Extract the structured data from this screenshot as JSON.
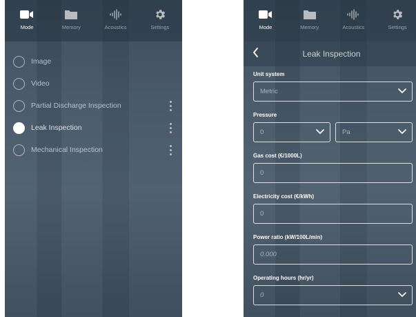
{
  "nav": {
    "mode": "Mode",
    "memory": "Memory",
    "acoustics": "Acoustics",
    "settings": "Settings"
  },
  "mode_list": {
    "items": [
      {
        "label": "Image",
        "selected": false
      },
      {
        "label": "Video",
        "selected": false
      },
      {
        "label": "Partial Discharge Inspection",
        "selected": false
      },
      {
        "label": "Leak Inspection",
        "selected": true
      },
      {
        "label": "Mechanical Inspection",
        "selected": false
      }
    ]
  },
  "leak_form": {
    "title": "Leak Inspection",
    "unit_system": {
      "label": "Unit system",
      "value": "Metric"
    },
    "pressure": {
      "label": "Pressure",
      "value": "0",
      "unit": "Pa"
    },
    "gas_cost": {
      "label": "Gas cost (€/1000L)",
      "value": "0"
    },
    "electricity_cost": {
      "label": "Electricity cost (€/kWh)",
      "value": "0"
    },
    "power_ratio": {
      "label": "Power ratio (kW/100L/min)",
      "placeholder": "0.000"
    },
    "operating_hours": {
      "label": "Operating hours (hr/yr)",
      "value": "0"
    }
  },
  "colors": {
    "background": "#455666",
    "text": "#ffffff"
  },
  "icons": {
    "mode": "video-camera-icon",
    "memory": "folder-icon",
    "acoustics": "sound-wave-icon",
    "settings": "gear-icon",
    "back": "chevron-left-icon",
    "dropdown": "chevron-down-icon",
    "more": "kebab-menu-icon"
  }
}
